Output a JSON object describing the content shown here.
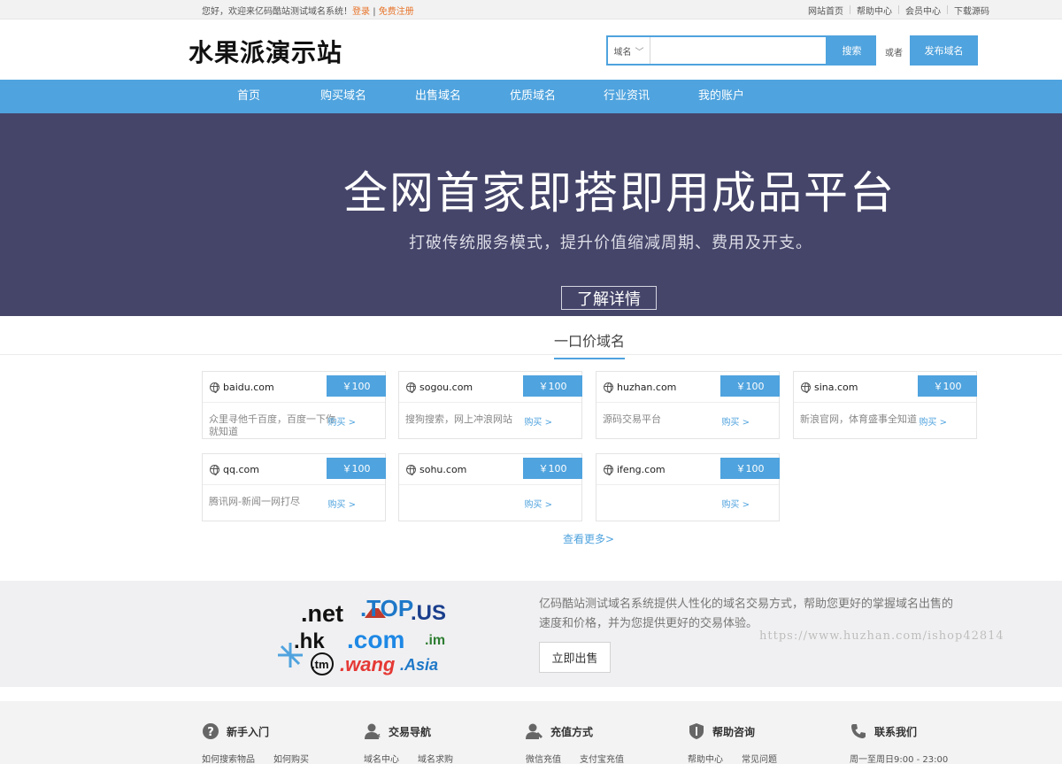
{
  "topbar": {
    "welcome": "您好，欢迎来亿码酷站测试域名系统！",
    "login": "登录",
    "divider": "|",
    "register": "免费注册",
    "links": [
      "网站首页",
      "帮助中心",
      "会员中心",
      "下载源码"
    ]
  },
  "header": {
    "logo": "水果派演示站",
    "search_type": "域名",
    "search_placeholder": "",
    "search_button": "搜索",
    "or_text": "或者",
    "publish_button": "发布域名"
  },
  "nav": [
    "首页",
    "购买域名",
    "出售域名",
    "优质域名",
    "行业资讯",
    "我的账户"
  ],
  "banner": {
    "title": "全网首家即搭即用成品平台",
    "subtitle": "打破传统服务模式，提升价值缩减周期、费用及开支。",
    "button": "了解详情"
  },
  "section": {
    "title": "一口价域名",
    "more": "查看更多>"
  },
  "domains": [
    {
      "name": "baidu.com",
      "price": "￥100",
      "desc": "众里寻他千百度，百度一下你就知道",
      "buy": "购买 >"
    },
    {
      "name": "sogou.com",
      "price": "￥100",
      "desc": "搜狗搜索，网上冲浪网站",
      "buy": "购买 >"
    },
    {
      "name": "huzhan.com",
      "price": "￥100",
      "desc": "源码交易平台",
      "buy": "购买 >"
    },
    {
      "name": "sina.com",
      "price": "￥100",
      "desc": "新浪官网，体育盛事全知道",
      "buy": "购买 >"
    },
    {
      "name": "qq.com",
      "price": "￥100",
      "desc": "腾讯网-新闻一网打尽",
      "buy": "购买 >"
    },
    {
      "name": "sohu.com",
      "price": "￥100",
      "desc": "",
      "buy": "购买 >"
    },
    {
      "name": "ifeng.com",
      "price": "￥100",
      "desc": "",
      "buy": "购买 >"
    }
  ],
  "promo": {
    "logo_words": [
      ".net",
      ".TOP",
      ".US",
      ".hk",
      ".com",
      ".im",
      ".tm",
      ".wang",
      ".Asia"
    ],
    "text": "亿码酷站测试域名系统提供人性化的域名交易方式，帮助您更好的掌握域名出售的速度和价格，并为您提供更好的交易体验。",
    "button": "立即出售",
    "watermark": "https://www.huzhan.com/ishop42814"
  },
  "footer": [
    {
      "title": "新手入门",
      "icon": "question-icon",
      "links": [
        "如何搜索物品",
        "如何购买"
      ]
    },
    {
      "title": "交易导航",
      "icon": "user-icon",
      "links": [
        "域名中心",
        "域名求购"
      ]
    },
    {
      "title": "充值方式",
      "icon": "user-wrench-icon",
      "links": [
        "微信充值",
        "支付宝充值"
      ]
    },
    {
      "title": "帮助咨询",
      "icon": "shield-icon",
      "links": [
        "帮助中心",
        "常见问题"
      ]
    },
    {
      "title": "联系我们",
      "icon": "phone-icon",
      "links": [
        "周一至周日9:00 - 23:00"
      ]
    }
  ]
}
